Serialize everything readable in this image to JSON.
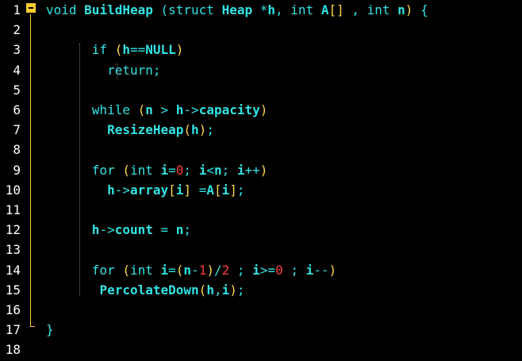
{
  "editor": {
    "lines": [
      {
        "n": "1",
        "tokens": [
          {
            "t": "void ",
            "c": "kw"
          },
          {
            "t": "BuildHeap",
            "c": "id"
          },
          {
            "t": " (struct ",
            "c": "kw"
          },
          {
            "t": "Heap",
            "c": "id"
          },
          {
            "t": " *",
            "c": "op"
          },
          {
            "t": "h",
            "c": "id"
          },
          {
            "t": ", int ",
            "c": "kw"
          },
          {
            "t": "A",
            "c": "id"
          },
          {
            "t": "[]",
            "c": "br"
          },
          {
            "t": " , int ",
            "c": "kw"
          },
          {
            "t": "n",
            "c": "id"
          },
          {
            "t": ")",
            "c": "br"
          },
          {
            "t": " {",
            "c": "op"
          }
        ]
      },
      {
        "n": "2",
        "tokens": []
      },
      {
        "n": "3",
        "tokens": [
          {
            "t": "      if ",
            "c": "kw"
          },
          {
            "t": "(",
            "c": "br"
          },
          {
            "t": "h",
            "c": "id"
          },
          {
            "t": "==",
            "c": "op"
          },
          {
            "t": "NULL",
            "c": "id"
          },
          {
            "t": ")",
            "c": "br"
          }
        ]
      },
      {
        "n": "4",
        "tokens": [
          {
            "t": "        return;",
            "c": "kw"
          }
        ]
      },
      {
        "n": "5",
        "tokens": []
      },
      {
        "n": "6",
        "tokens": [
          {
            "t": "      while ",
            "c": "kw"
          },
          {
            "t": "(",
            "c": "br"
          },
          {
            "t": "n",
            "c": "id"
          },
          {
            "t": " > ",
            "c": "op"
          },
          {
            "t": "h",
            "c": "id"
          },
          {
            "t": "->",
            "c": "op"
          },
          {
            "t": "capacity",
            "c": "id"
          },
          {
            "t": ")",
            "c": "br"
          }
        ]
      },
      {
        "n": "7",
        "tokens": [
          {
            "t": "        ",
            "c": "kw"
          },
          {
            "t": "ResizeHeap",
            "c": "id"
          },
          {
            "t": "(",
            "c": "br"
          },
          {
            "t": "h",
            "c": "id"
          },
          {
            "t": ")",
            "c": "br"
          },
          {
            "t": ";",
            "c": "op"
          }
        ]
      },
      {
        "n": "8",
        "tokens": []
      },
      {
        "n": "9",
        "tokens": [
          {
            "t": "      for ",
            "c": "kw"
          },
          {
            "t": "(",
            "c": "br"
          },
          {
            "t": "int ",
            "c": "kw"
          },
          {
            "t": "i",
            "c": "id"
          },
          {
            "t": "=",
            "c": "op"
          },
          {
            "t": "0",
            "c": "num"
          },
          {
            "t": "; ",
            "c": "op"
          },
          {
            "t": "i",
            "c": "id"
          },
          {
            "t": "<",
            "c": "op"
          },
          {
            "t": "n",
            "c": "id"
          },
          {
            "t": "; ",
            "c": "op"
          },
          {
            "t": "i",
            "c": "id"
          },
          {
            "t": "++",
            "c": "op"
          },
          {
            "t": ")",
            "c": "br"
          }
        ]
      },
      {
        "n": "10",
        "tokens": [
          {
            "t": "        ",
            "c": "kw"
          },
          {
            "t": "h",
            "c": "id"
          },
          {
            "t": "->",
            "c": "op"
          },
          {
            "t": "array",
            "c": "id"
          },
          {
            "t": "[",
            "c": "br"
          },
          {
            "t": "i",
            "c": "id"
          },
          {
            "t": "]",
            "c": "br"
          },
          {
            "t": " =",
            "c": "op"
          },
          {
            "t": "A",
            "c": "id"
          },
          {
            "t": "[",
            "c": "br"
          },
          {
            "t": "i",
            "c": "id"
          },
          {
            "t": "]",
            "c": "br"
          },
          {
            "t": ";",
            "c": "op"
          }
        ]
      },
      {
        "n": "11",
        "tokens": []
      },
      {
        "n": "12",
        "tokens": [
          {
            "t": "      ",
            "c": "kw"
          },
          {
            "t": "h",
            "c": "id"
          },
          {
            "t": "->",
            "c": "op"
          },
          {
            "t": "count",
            "c": "id"
          },
          {
            "t": " = ",
            "c": "op"
          },
          {
            "t": "n",
            "c": "id"
          },
          {
            "t": ";",
            "c": "op"
          }
        ]
      },
      {
        "n": "13",
        "tokens": []
      },
      {
        "n": "14",
        "tokens": [
          {
            "t": "      for ",
            "c": "kw"
          },
          {
            "t": "(",
            "c": "br"
          },
          {
            "t": "int ",
            "c": "kw"
          },
          {
            "t": "i",
            "c": "id"
          },
          {
            "t": "=",
            "c": "op"
          },
          {
            "t": "(",
            "c": "br"
          },
          {
            "t": "n",
            "c": "id"
          },
          {
            "t": "-",
            "c": "op"
          },
          {
            "t": "1",
            "c": "num"
          },
          {
            "t": ")",
            "c": "br"
          },
          {
            "t": "/",
            "c": "op"
          },
          {
            "t": "2",
            "c": "num"
          },
          {
            "t": " ; ",
            "c": "op"
          },
          {
            "t": "i",
            "c": "id"
          },
          {
            "t": ">=",
            "c": "op"
          },
          {
            "t": "0",
            "c": "num"
          },
          {
            "t": " ; ",
            "c": "op"
          },
          {
            "t": "i",
            "c": "id"
          },
          {
            "t": "--",
            "c": "op"
          },
          {
            "t": ")",
            "c": "br"
          }
        ]
      },
      {
        "n": "15",
        "tokens": [
          {
            "t": "       ",
            "c": "kw"
          },
          {
            "t": "PercolateDown",
            "c": "id"
          },
          {
            "t": "(",
            "c": "br"
          },
          {
            "t": "h",
            "c": "id"
          },
          {
            "t": ",",
            "c": "op"
          },
          {
            "t": "i",
            "c": "id"
          },
          {
            "t": ")",
            "c": "br"
          },
          {
            "t": ";",
            "c": "op"
          }
        ]
      },
      {
        "n": "16",
        "tokens": []
      },
      {
        "n": "17",
        "tokens": [
          {
            "t": "}",
            "c": "op"
          }
        ]
      },
      {
        "n": "18",
        "tokens": []
      }
    ],
    "colors": {
      "background": "#000000",
      "keyword": "#32e3e3",
      "number": "#ff3b3b",
      "bracket": "#ffd84a",
      "fold": "#ffcc33",
      "line_number": "#ffffff"
    }
  }
}
